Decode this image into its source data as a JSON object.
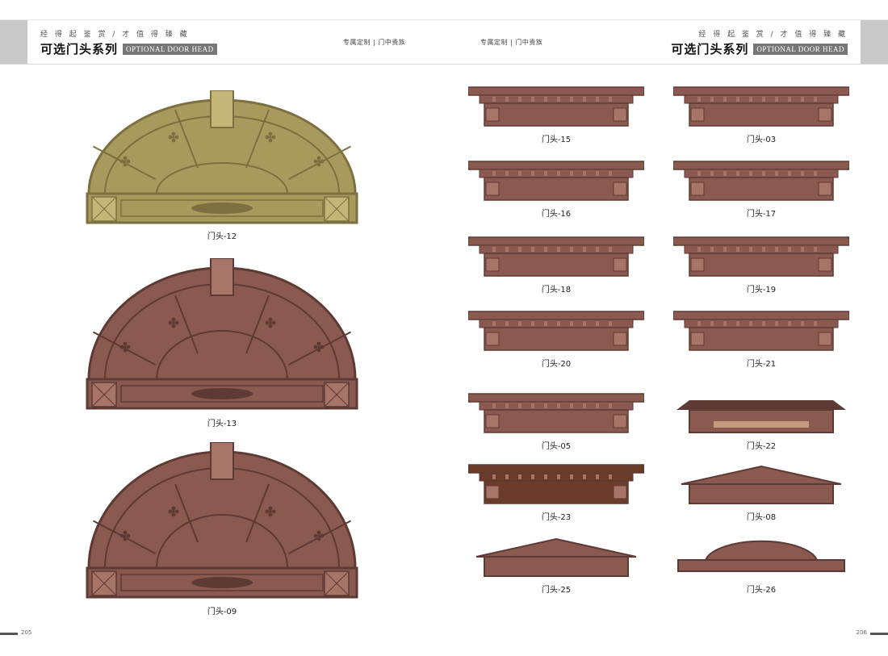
{
  "header": {
    "slogan": "经 得 起 鉴 赏 / 才 值 得 臻 藏",
    "title": "可选门头系列",
    "title_en": "OPTIONAL DOOR HEAD",
    "tag_left": "专属定制 | 门中贵族",
    "tag_right": "专属定制 | 门中贵族"
  },
  "left_items": [
    {
      "caption": "门头-12",
      "finish": "brass"
    },
    {
      "caption": "门头-13",
      "finish": "copper"
    },
    {
      "caption": "门头-09",
      "finish": "copper"
    }
  ],
  "right_items": [
    {
      "caption": "门头-15",
      "style": "flat"
    },
    {
      "caption": "门头-03",
      "style": "flat"
    },
    {
      "caption": "门头-16",
      "style": "flat"
    },
    {
      "caption": "门头-17",
      "style": "flat"
    },
    {
      "caption": "门头-18",
      "style": "flat"
    },
    {
      "caption": "门头-19",
      "style": "flat"
    },
    {
      "caption": "门头-20",
      "style": "flat"
    },
    {
      "caption": "门头-21",
      "style": "flat"
    },
    {
      "caption": "门头-05",
      "style": "flat"
    },
    {
      "caption": "门头-22",
      "style": "roof"
    },
    {
      "caption": "门头-23",
      "style": "dark"
    },
    {
      "caption": "门头-08",
      "style": "pediment"
    },
    {
      "caption": "门头-25",
      "style": "pediment"
    },
    {
      "caption": "门头-26",
      "style": "arch"
    }
  ],
  "colors": {
    "brass": "#a89a5c",
    "brass_dark": "#7d7040",
    "copper": "#8a5a50",
    "copper_dark": "#5e3a34",
    "copper_light": "#a77568"
  },
  "footer": {
    "page_left": "205",
    "page_right": "206"
  }
}
